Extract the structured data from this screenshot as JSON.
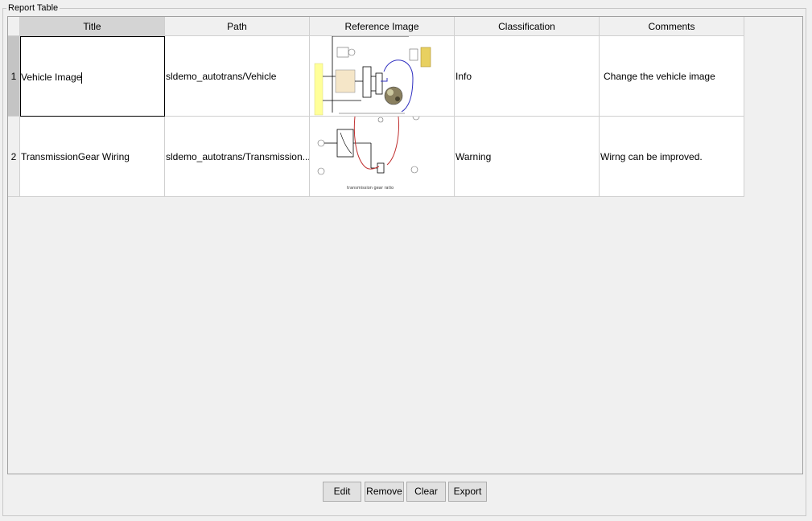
{
  "panel": {
    "title": "Report Table"
  },
  "table": {
    "columns": [
      "Title",
      "Path",
      "Reference Image",
      "Classification",
      "Comments"
    ],
    "rows": [
      {
        "index": "1",
        "title": "Vehicle Image",
        "path": "sldemo_autotrans/Vehicle",
        "classification": "Info",
        "comments": "Change the vehicle image"
      },
      {
        "index": "2",
        "title": "TransmissionGear Wiring",
        "path": "sldemo_autotrans/Transmission...",
        "classification": "Warning",
        "comments": "Wirng can be improved."
      }
    ],
    "image_captions": {
      "row2": "transmission gear ratio"
    }
  },
  "buttons": {
    "edit": "Edit",
    "remove": "Remove",
    "clear": "Clear",
    "export": "Export"
  },
  "colors": {
    "selected_header": "#d4d4d4",
    "yellow_block": "#ffff99",
    "wire_blue": "#3030c0",
    "wire_red": "#c03030"
  }
}
